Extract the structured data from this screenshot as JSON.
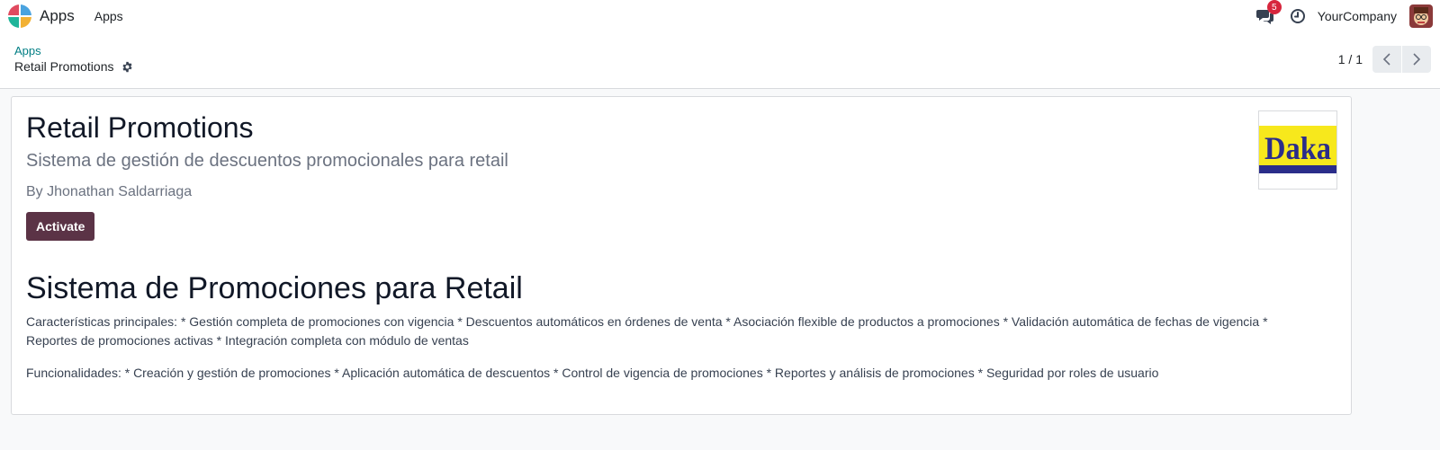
{
  "navbar": {
    "app_name": "Apps",
    "menu_item": "Apps",
    "messages_badge": "5",
    "company": "YourCompany",
    "icons": [
      "odoo-logo-icon",
      "chat-icon",
      "clock-icon",
      "avatar"
    ]
  },
  "control_panel": {
    "breadcrumb_parent": "Apps",
    "breadcrumb_current": "Retail Promotions",
    "pager_value": "1 / 1"
  },
  "module": {
    "title": "Retail Promotions",
    "summary": "Sistema de gestión de descuentos promocionales para retail",
    "author": "By Jhonathan Saldarriaga",
    "activate_label": "Activate",
    "icon_text": "Daka"
  },
  "description": {
    "title": "Sistema de Promociones para Retail",
    "paragraph1": "Características principales: * Gestión completa de promociones con vigencia * Descuentos automáticos en órdenes de venta * Asociación flexible de productos a promociones * Validación automática de fechas de vigencia * Reportes de promociones activas * Integración completa con módulo de ventas",
    "paragraph2": "Funcionalidades: * Creación y gestión de promociones * Aplicación automática de descuentos * Control de vigencia de promociones * Reportes y análisis de promociones * Seguridad por roles de usuario"
  },
  "colors": {
    "primary": "#5b3346",
    "link": "#017e84",
    "badge": "#d7263d",
    "icon_yellow": "#f7e81c",
    "icon_blue": "#2b2d8a"
  }
}
